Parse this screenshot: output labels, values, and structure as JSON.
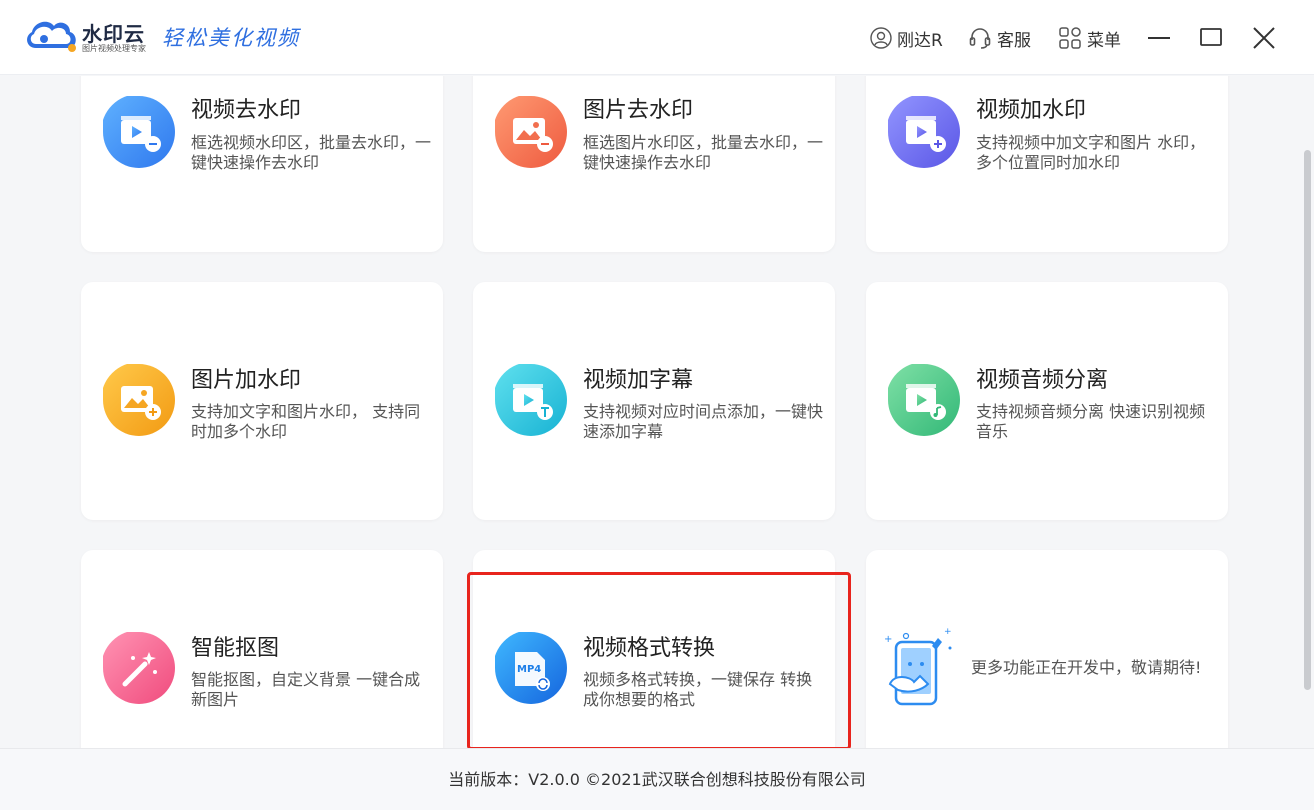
{
  "header": {
    "app_name": "水印云",
    "app_subtitle": "图片视频处理专家",
    "slogan": "轻松美化视频",
    "user_label": "刚达R",
    "service_label": "客服",
    "menu_label": "菜单"
  },
  "cards": [
    {
      "title": "视频去水印",
      "desc": "框选视频水印区，批量去水印，一键快速操作去水印",
      "color": "#3a8ef6",
      "icon": "video-minus-icon"
    },
    {
      "title": "图片去水印",
      "desc": "框选图片水印区，批量去水印，一键快速操作去水印",
      "color": "#f26f4e",
      "icon": "image-minus-icon"
    },
    {
      "title": "视频加水印",
      "desc": "支持视频中加文字和图片 水印，多个位置同时加水印",
      "color": "#6b6cf0",
      "icon": "video-plus-icon"
    },
    {
      "title": "图片加水印",
      "desc": "支持加文字和图片水印， 支持同时加多个水印",
      "color": "#f5a623",
      "icon": "image-plus-icon"
    },
    {
      "title": "视频加字幕",
      "desc": "支持视频对应时间点添加，一键快速添加字幕",
      "color": "#27c3df",
      "icon": "video-text-icon"
    },
    {
      "title": "视频音频分离",
      "desc": "支持视频音频分离 快速识别视频音乐",
      "color": "#4cc98a",
      "icon": "video-music-icon"
    },
    {
      "title": "智能抠图",
      "desc": "智能抠图，自定义背景 一键合成新图片",
      "color": "#f55a8a",
      "icon": "magic-wand-icon"
    },
    {
      "title": "视频格式转换",
      "desc": "视频多格式转换，一键保存 转换成你想要的格式",
      "color": "#1d7fe8",
      "icon": "mp4-convert-icon",
      "badge": "MP4"
    },
    {
      "title": "",
      "desc": "更多功能正在开发中，敬请期待!",
      "color": "#2d8cf0",
      "icon": "developing-robot-icon"
    }
  ],
  "footer": {
    "text": "当前版本：V2.0.0 ©2021武汉联合创想科技股份有限公司"
  }
}
